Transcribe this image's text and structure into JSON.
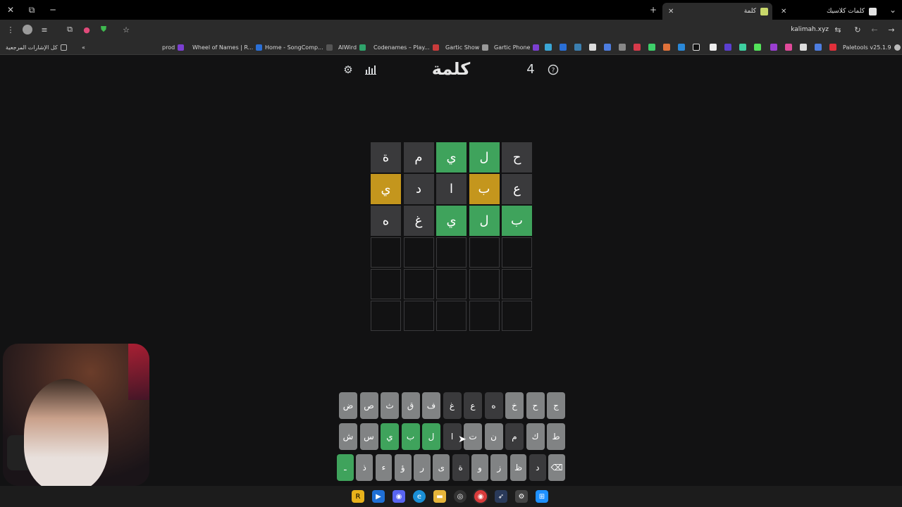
{
  "browser": {
    "tabs": [
      {
        "label": "كلمات كلاسيك"
      },
      {
        "label": "كلمة"
      }
    ],
    "url": "kalimah.xyz",
    "bookmarks": [
      {
        "label": "prod",
        "color": "#7b3fd1"
      },
      {
        "label": "Wheel of Names | R...",
        "color": "#2a6fd6"
      },
      {
        "label": "Home - SongComp...",
        "color": "#555"
      },
      {
        "label": "AIWird",
        "color": "#2fa36b"
      },
      {
        "label": "Codenames – Play...",
        "color": "#c93b3b"
      },
      {
        "label": "Gartic Show",
        "color": "#999"
      },
      {
        "label": "Gartic Phone",
        "color": "#7b3fd1"
      }
    ],
    "bookmarks_right": "Paletools v25.1.9",
    "bookmarks_all": "كل الإشارات المرجعية"
  },
  "game": {
    "title": "كلمة",
    "count": "4",
    "icons": [
      "settings-icon",
      "stats-icon",
      "help-icon"
    ],
    "board": [
      [
        {
          "letter": "ح",
          "state": "absent"
        },
        {
          "letter": "ل",
          "state": "correct"
        },
        {
          "letter": "ي",
          "state": "correct"
        },
        {
          "letter": "م",
          "state": "absent"
        },
        {
          "letter": "ة",
          "state": "absent"
        }
      ],
      [
        {
          "letter": "ع",
          "state": "absent"
        },
        {
          "letter": "ب",
          "state": "present"
        },
        {
          "letter": "ا",
          "state": "absent"
        },
        {
          "letter": "د",
          "state": "absent"
        },
        {
          "letter": "ي",
          "state": "present"
        }
      ],
      [
        {
          "letter": "ب",
          "state": "correct"
        },
        {
          "letter": "ل",
          "state": "correct"
        },
        {
          "letter": "ي",
          "state": "correct"
        },
        {
          "letter": "غ",
          "state": "absent"
        },
        {
          "letter": "ه",
          "state": "absent"
        }
      ],
      [
        {
          "letter": "",
          "state": "empty"
        },
        {
          "letter": "",
          "state": "empty"
        },
        {
          "letter": "",
          "state": "empty"
        },
        {
          "letter": "",
          "state": "empty"
        },
        {
          "letter": "",
          "state": "empty"
        }
      ],
      [
        {
          "letter": "",
          "state": "empty"
        },
        {
          "letter": "",
          "state": "empty"
        },
        {
          "letter": "",
          "state": "empty"
        },
        {
          "letter": "",
          "state": "empty"
        },
        {
          "letter": "",
          "state": "empty"
        }
      ],
      [
        {
          "letter": "",
          "state": "empty"
        },
        {
          "letter": "",
          "state": "empty"
        },
        {
          "letter": "",
          "state": "empty"
        },
        {
          "letter": "",
          "state": "empty"
        },
        {
          "letter": "",
          "state": "empty"
        }
      ]
    ],
    "keyboard": [
      [
        {
          "k": "ج",
          "s": "u"
        },
        {
          "k": "ح",
          "s": "u"
        },
        {
          "k": "خ",
          "s": "u"
        },
        {
          "k": "ه",
          "s": "a"
        },
        {
          "k": "ع",
          "s": "a"
        },
        {
          "k": "غ",
          "s": "a"
        },
        {
          "k": "ف",
          "s": "u"
        },
        {
          "k": "ق",
          "s": "u"
        },
        {
          "k": "ث",
          "s": "u"
        },
        {
          "k": "ص",
          "s": "u"
        },
        {
          "k": "ض",
          "s": "u"
        }
      ],
      [
        {
          "k": "ط",
          "s": "u"
        },
        {
          "k": "ك",
          "s": "u"
        },
        {
          "k": "م",
          "s": "a"
        },
        {
          "k": "ن",
          "s": "u"
        },
        {
          "k": "ت",
          "s": "u"
        },
        {
          "k": "ا",
          "s": "a"
        },
        {
          "k": "ل",
          "s": "g"
        },
        {
          "k": "ب",
          "s": "g"
        },
        {
          "k": "ي",
          "s": "g"
        },
        {
          "k": "س",
          "s": "u"
        },
        {
          "k": "ش",
          "s": "u"
        }
      ],
      [
        {
          "k": "⌫",
          "s": "u"
        },
        {
          "k": "د",
          "s": "a"
        },
        {
          "k": "ظ",
          "s": "u"
        },
        {
          "k": "ز",
          "s": "u"
        },
        {
          "k": "و",
          "s": "u"
        },
        {
          "k": "ة",
          "s": "a"
        },
        {
          "k": "ى",
          "s": "u"
        },
        {
          "k": "ر",
          "s": "u"
        },
        {
          "k": "ؤ",
          "s": "u"
        },
        {
          "k": "ء",
          "s": "u"
        },
        {
          "k": "ذ",
          "s": "u"
        },
        {
          "k": "ـ",
          "s": "g"
        }
      ]
    ]
  },
  "colors": {
    "correct": "#3fa35c",
    "present": "#c4961d",
    "absent": "#3a3a3c",
    "key": "#818384",
    "background": "#121213"
  }
}
